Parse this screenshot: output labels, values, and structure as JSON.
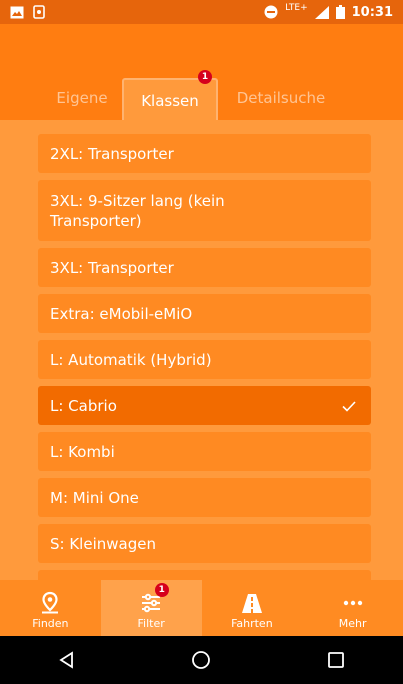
{
  "status_bar": {
    "network_label": "LTE+",
    "time": "10:31"
  },
  "tabs": [
    {
      "label": "Eigene",
      "active": false
    },
    {
      "label": "Klassen",
      "active": true,
      "badge": "1"
    },
    {
      "label": "Detailsuche",
      "active": false
    }
  ],
  "vehicle_classes": [
    {
      "label": "2XL: Transporter",
      "selected": false
    },
    {
      "label": "3XL: 9-Sitzer lang (kein Transporter)",
      "selected": false
    },
    {
      "label": "3XL: Transporter",
      "selected": false
    },
    {
      "label": "Extra: eMobil-eMiO",
      "selected": false
    },
    {
      "label": "L: Automatik (Hybrid)",
      "selected": false
    },
    {
      "label": "L: Cabrio",
      "selected": true
    },
    {
      "label": "L: Kombi",
      "selected": false
    },
    {
      "label": "M: Mini One",
      "selected": false
    },
    {
      "label": "S: Kleinwagen",
      "selected": false
    }
  ],
  "bottom_nav": [
    {
      "label": "Finden",
      "icon": "map-pin-icon",
      "active": false
    },
    {
      "label": "Filter",
      "icon": "filter-sliders-icon",
      "active": true,
      "badge": "1"
    },
    {
      "label": "Fahrten",
      "icon": "road-icon",
      "active": false
    },
    {
      "label": "Mehr",
      "icon": "more-dots-icon",
      "active": false
    }
  ],
  "colors": {
    "header": "#ff7d11",
    "background": "#ff9a3c",
    "list_item": "#ff8a22",
    "selected_item": "#f26b00",
    "badge": "#d6001c"
  }
}
